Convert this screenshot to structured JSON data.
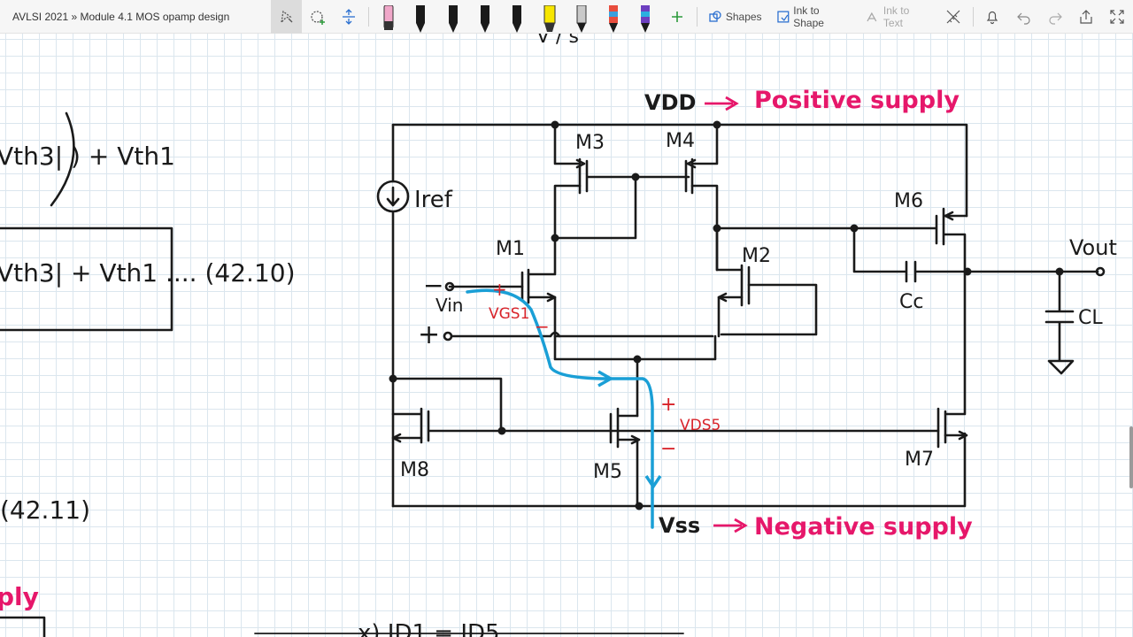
{
  "window": {
    "title": "AVLSI 2021 » Module 4.1 MOS opamp design"
  },
  "toolbar": {
    "shapes_label": "Shapes",
    "ink_to_shape_label": "Ink to Shape",
    "ink_to_text_label": "Ink to Text",
    "icons": [
      "lasso-select-icon",
      "add-space-icon",
      "insert-space-icon",
      "eraser-icon",
      "pen-icon",
      "highlighter-icon",
      "add-pen-icon",
      "ruler-icon",
      "bell-icon",
      "undo-icon",
      "redo-icon",
      "share-icon",
      "fullscreen-icon"
    ],
    "pen_colors": [
      "#1a1a1a",
      "#1a1a1a",
      "#1a1a1a",
      "#1a1a1a",
      "#f7e600",
      "#1a1a1a",
      "#1a1a1a",
      "#1a1a1a"
    ]
  },
  "notes": {
    "left_top": "Vth3| ) + Vth1",
    "left_box": "Vth3| + Vth1 .... (42.10)",
    "eq_42_11": "(42.11)",
    "left_pink": "ply",
    "bottom_partial": "x)  ID1 = ID5",
    "top_partial": "V   / s"
  },
  "circuit": {
    "vdd_label": "VDD",
    "vdd_desc": "Positive supply",
    "vss_label": "Vss",
    "vss_desc": "Negative supply",
    "iref": "Iref",
    "vin": "Vin",
    "vout": "Vout",
    "cc": "Cc",
    "cl": "CL",
    "minus_in": "−",
    "plus_in": "+",
    "m1": "M1",
    "m2": "M2",
    "m3": "M3",
    "m4": "M4",
    "m5": "M5",
    "m6": "M6",
    "m7": "M7",
    "m8": "M8",
    "vgs1": "VGS1",
    "vds5": "VDS5",
    "vgs_plus": "+",
    "vgs_minus": "−",
    "vds_plus": "+",
    "vds_minus": "−",
    "arrow": "→"
  },
  "colors": {
    "ink": "#1a1a1a",
    "pink": "#e6176a",
    "red": "#d8232a",
    "blue": "#1a9fd6",
    "grid": "#dbe6ee"
  }
}
